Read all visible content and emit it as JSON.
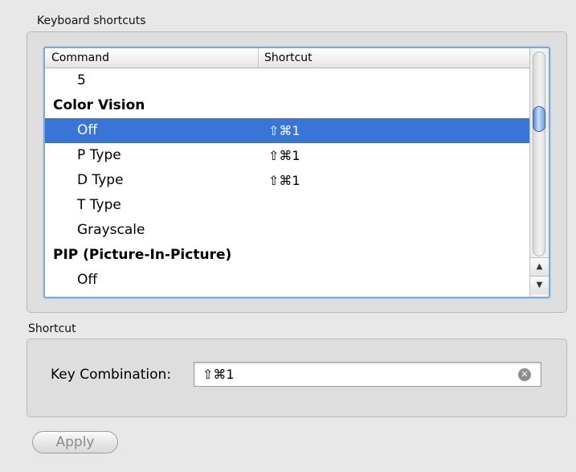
{
  "keyboard_shortcuts": {
    "group_label": "Keyboard shortcuts",
    "columns": [
      "Command",
      "Shortcut"
    ],
    "rows": [
      {
        "command": "5",
        "shortcut": "",
        "group": false,
        "selected": false
      },
      {
        "command": "Color Vision",
        "shortcut": "",
        "group": true,
        "selected": false
      },
      {
        "command": "Off",
        "shortcut": "⇧⌘1",
        "group": false,
        "selected": true
      },
      {
        "command": "P Type",
        "shortcut": "⇧⌘1",
        "group": false,
        "selected": false
      },
      {
        "command": "D Type",
        "shortcut": "⇧⌘1",
        "group": false,
        "selected": false
      },
      {
        "command": "T Type",
        "shortcut": "",
        "group": false,
        "selected": false
      },
      {
        "command": "Grayscale",
        "shortcut": "",
        "group": false,
        "selected": false
      },
      {
        "command": "PIP (Picture-In-Picture)",
        "shortcut": "",
        "group": true,
        "selected": false
      },
      {
        "command": "Off",
        "shortcut": "",
        "group": false,
        "selected": false
      }
    ],
    "scroll_up_icon": "▲",
    "scroll_down_icon": "▼"
  },
  "shortcut": {
    "group_label": "Shortcut",
    "key_combination_label": "Key Combination:",
    "key_combination_value": "⇧⌘1",
    "clear_icon": "✕"
  },
  "apply_button": {
    "label": "Apply",
    "enabled": false
  },
  "colors": {
    "selection": "#3875d7",
    "focus_ring": "#7ea7dc",
    "background": "#e8e8e8"
  }
}
